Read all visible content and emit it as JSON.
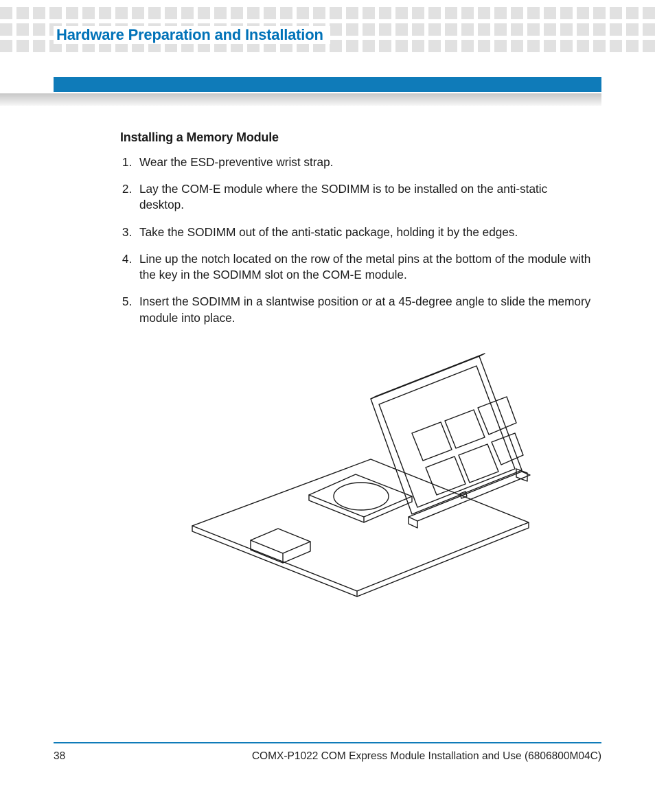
{
  "header": {
    "chapter_title": "Hardware Preparation and Installation"
  },
  "colors": {
    "accent": "#0f7bb9"
  },
  "section": {
    "title": "Installing a Memory Module",
    "steps": [
      "Wear the ESD-preventive wrist strap.",
      "Lay the COM-E module where the SODIMM is to be installed on the anti-static desktop.",
      "Take the SODIMM out of the anti-static package, holding it by the edges.",
      "Line up the notch located on the row of the metal pins at the bottom of the module with the key in the SODIMM slot on the COM-E module.",
      "Insert the SODIMM in a slantwise position or at a 45-degree angle to slide the memory module into place."
    ]
  },
  "figure": {
    "alt": "Line drawing of a COM-E module board with a SODIMM memory module being inserted at an angle into the slot."
  },
  "footer": {
    "page_number": "38",
    "doc_title": "COMX-P1022 COM Express Module Installation and Use (6806800M04C)"
  }
}
